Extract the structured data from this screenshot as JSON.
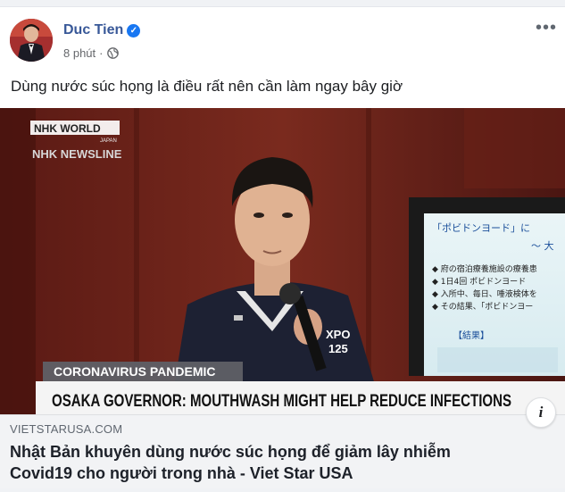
{
  "post": {
    "author": "Duc Tien",
    "timestamp": "8 phút",
    "separator": "·",
    "privacy_icon": "globe-icon",
    "verified_icon": "verified-badge-icon",
    "more_label": "•••",
    "text": "Dùng nước súc họng là điều rất nên cần làm ngay bây giờ"
  },
  "media": {
    "channel_logo": "NHK WORLD",
    "channel_sub": "JAPAN",
    "channel_show": "NHK NEWSLINE",
    "lower_third_tag": "CORONAVIRUS PANDEMIC",
    "lower_third_headline": "OSAKA GOVERNOR: MOUTHWASH MIGHT HELP REDUCE INFECTIONS",
    "shirt_text_1": "XPO",
    "shirt_text_2": "125",
    "slide_title_1": "「ポビドンヨード」に",
    "slide_title_2": "～ 大",
    "slide_bullets": [
      "◆ 府の宿泊療養施設の療養患",
      "◆ 1日4回 ポビドンヨード",
      "◆ 入所中、毎日、唾液検体を",
      "◆ その結果、「ポビドンヨー"
    ],
    "slide_result": "【結果】"
  },
  "link": {
    "domain": "VIETSTARUSA.COM",
    "title": "Nhật Bản khuyên dùng nước súc họng để giảm lây nhiễm Covid19 cho người trong nhà - Viet Star USA",
    "info_label": "i"
  },
  "colors": {
    "author": "#385898",
    "verified": "#1877f2",
    "link_bg": "#f2f3f5"
  }
}
